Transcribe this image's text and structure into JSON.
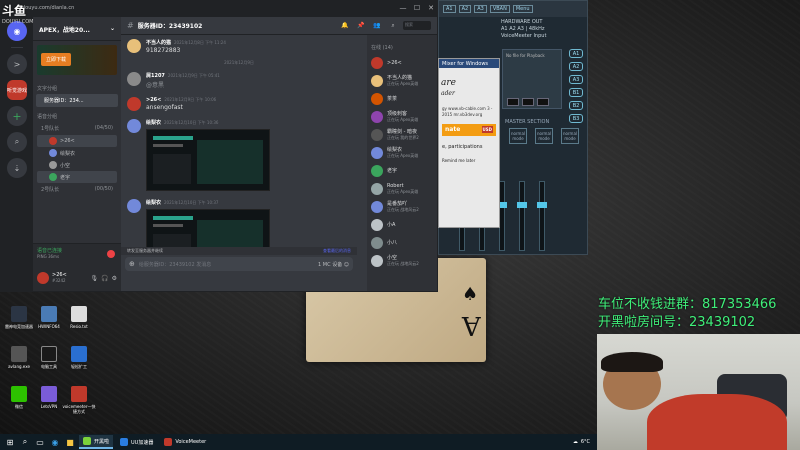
{
  "watermark": {
    "main": "斗鱼",
    "sub": "DOUYU.COM"
  },
  "titlebar": {
    "title": "douyu.com/dianla.cn",
    "min": "—",
    "max": "☐",
    "close": "✕"
  },
  "discord": {
    "guild": "APEX，战地20...",
    "guild_menu": "⌄",
    "banner_button": "立即下载",
    "categories": {
      "text": "文字分组",
      "voice": "语音分组"
    },
    "channel_selected": "服务器ID：234...",
    "voice_channels": [
      {
        "name": "1号队长",
        "count": "(04/50)"
      },
      {
        "name": "2号队长",
        "count": "(00/50)"
      }
    ],
    "voice_users": [
      ">26<",
      "绘梨衣",
      "小空",
      "老宇"
    ],
    "voice_conn": {
      "status": "语音已连接",
      "sub": "PING 36ms"
    },
    "user": {
      "name": ">26<",
      "tag": "#3242"
    },
    "servers": [
      "⌂",
      "+",
      "⌕",
      "⇣"
    ],
    "active_server_label": "听觉游戏",
    "chat": {
      "channel": "服务器ID：23439102",
      "search_placeholder": "搜索",
      "messages": [
        {
          "user": "不当人的猫",
          "time": "2021年12月8日 下午 11:24",
          "text": "918272883"
        },
        {
          "user": "屑1207",
          "time": "2021年12月9日 下午 05:41",
          "text": "@意黑"
        },
        {
          "user": ">26<",
          "time": "2021年12月9日 下午 10:06",
          "text": "ansengofast"
        },
        {
          "user": "绘梨衣",
          "time": "2021年12月10日 下午 10:36",
          "text": ""
        },
        {
          "user": "绘梨衣",
          "time": "2021年12月10日 下午 10:37",
          "text": ""
        }
      ],
      "divider": "2021年12月9日",
      "reply_bar": "转发至服务器并继续",
      "reply_right": "查看最后的消息",
      "input_placeholder": "给服务器ID：23439102 发消息",
      "input_hint": "1 MC 设备 ☺"
    },
    "members_header": "在线 (14)",
    "members": [
      {
        "name": ">26<",
        "status": ""
      },
      {
        "name": "不当人的猫",
        "status": "正在玩 Apex英雄"
      },
      {
        "name": "茶茶",
        "status": ""
      },
      {
        "name": "顶级刺客",
        "status": "正在玩 Apex英雄"
      },
      {
        "name": "霸瞳剑 - 暗夜",
        "status": "正在玩 我的世界2"
      },
      {
        "name": "绘梨衣",
        "status": "正在玩 Apex英雄"
      },
      {
        "name": "老宇",
        "status": ""
      },
      {
        "name": "Robert",
        "status": "正在玩 Apex英雄"
      },
      {
        "name": "是番茄吖",
        "status": "正在玩 战地风云2"
      },
      {
        "name": "小A",
        "status": ""
      },
      {
        "name": "小八",
        "status": ""
      },
      {
        "name": "小空",
        "status": "正在玩 战地风云2"
      }
    ]
  },
  "voicemeeter": {
    "tab_vban": "VBAN",
    "tab_menu": "Menu",
    "hw_out_title": "HARDWARE OUT",
    "hw_out_sub": "A1 A2 A3 | 48kHz",
    "hw_out_device": "VoiceMeeter Input",
    "slots": [
      "A1",
      "A2",
      "A3",
      "B1",
      "B2",
      "B3"
    ],
    "section": "MASTER SECTION",
    "modes": [
      "normal mode",
      "normal mode",
      "normal mode"
    ],
    "tape": "No file for Playback"
  },
  "popup": {
    "title": "Mixer for Windows",
    "logo": "are",
    "logo_sub": "ader",
    "info": "gy  www.vb-cable.com  3 - 2015  mr.vb3dev.org",
    "donate": "nate",
    "donate_usd": "USD",
    "message": "e, participations",
    "checkbox": "Remind me later"
  },
  "desktop_icons": [
    {
      "label": "雷神电竞加速器",
      "color": "#2b3544"
    },
    {
      "label": "HWINFO64",
      "color": "#4a7bb5"
    },
    {
      "label": "Resio.txt",
      "color": "#ddd"
    },
    {
      "label": "avlang.exe",
      "color": "#555"
    },
    {
      "label": "电脑工具",
      "color": "#1a1a1a"
    },
    {
      "label": "轻松扩工",
      "color": "#2a6fd0"
    },
    {
      "label": "微信",
      "color": "#2dc100"
    },
    {
      "label": "LetsVPN",
      "color": "#7a5cd8"
    },
    {
      "label": "voicemeeter一快捷方式",
      "color": "#c0392b"
    }
  ],
  "overlay": {
    "line1": "车位不收钱进群：817353466",
    "line2": "开黑啦房间号：23439102"
  },
  "taskbar": {
    "items": [
      {
        "label": "开黑啦",
        "active": true
      },
      {
        "label": "UU加速器",
        "active": false
      },
      {
        "label": "VoiceMeeter",
        "active": false
      }
    ],
    "weather": "6°C"
  }
}
